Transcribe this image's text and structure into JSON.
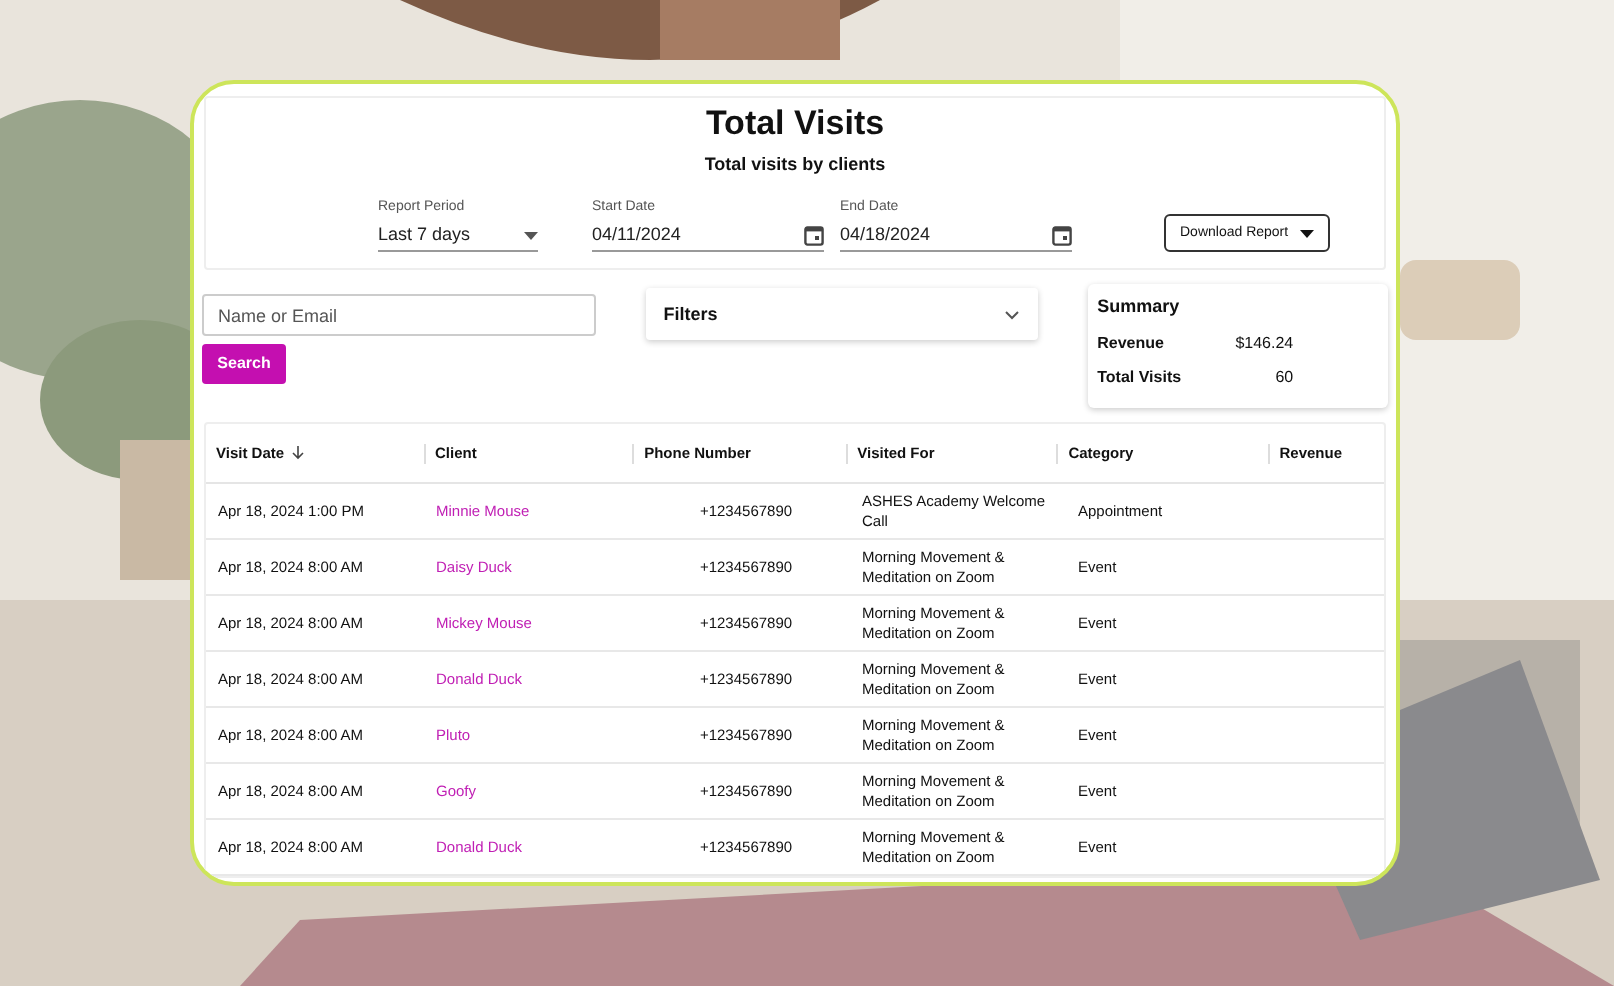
{
  "header": {
    "title": "Total Visits",
    "subtitle": "Total visits by clients"
  },
  "report_period": {
    "label": "Report Period",
    "value": "Last 7 days"
  },
  "start_date": {
    "label": "Start Date",
    "value": "04/11/2024"
  },
  "end_date": {
    "label": "End Date",
    "value": "04/18/2024"
  },
  "download_button": "Download Report",
  "search": {
    "placeholder": "Name or Email",
    "button": "Search"
  },
  "filters": {
    "label": "Filters",
    "expanded": false
  },
  "summary": {
    "title": "Summary",
    "rows": [
      {
        "label": "Revenue",
        "value": "$146.24"
      },
      {
        "label": "Total Visits",
        "value": "60"
      }
    ]
  },
  "table": {
    "columns": [
      "Visit Date",
      "Client",
      "Phone Number",
      "Visited For",
      "Category",
      "Revenue"
    ],
    "rows": [
      {
        "visit_date": "Apr 18, 2024 1:00 PM",
        "client": "Minnie Mouse",
        "phone": "+1234567890",
        "visited_for": "ASHES Academy Welcome Call",
        "category": "Appointment"
      },
      {
        "visit_date": "Apr 18, 2024 8:00 AM",
        "client": "Daisy Duck",
        "phone": "+1234567890",
        "visited_for": "Morning Movement & Meditation on Zoom",
        "category": "Event"
      },
      {
        "visit_date": "Apr 18, 2024 8:00 AM",
        "client": "Mickey Mouse",
        "phone": "+1234567890",
        "visited_for": "Morning Movement & Meditation on Zoom",
        "category": "Event"
      },
      {
        "visit_date": "Apr 18, 2024 8:00 AM",
        "client": "Donald Duck",
        "phone": "+1234567890",
        "visited_for": "Morning Movement & Meditation on Zoom",
        "category": "Event"
      },
      {
        "visit_date": "Apr 18, 2024 8:00 AM",
        "client": "Pluto",
        "phone": "+1234567890",
        "visited_for": "Morning Movement & Meditation on Zoom",
        "category": "Event"
      },
      {
        "visit_date": "Apr 18, 2024 8:00 AM",
        "client": "Goofy",
        "phone": "+1234567890",
        "visited_for": "Morning Movement & Meditation on Zoom",
        "category": "Event"
      },
      {
        "visit_date": "Apr 18, 2024 8:00 AM",
        "client": "Donald Duck",
        "phone": "+1234567890",
        "visited_for": "Morning Movement & Meditation on Zoom",
        "category": "Event"
      }
    ]
  }
}
